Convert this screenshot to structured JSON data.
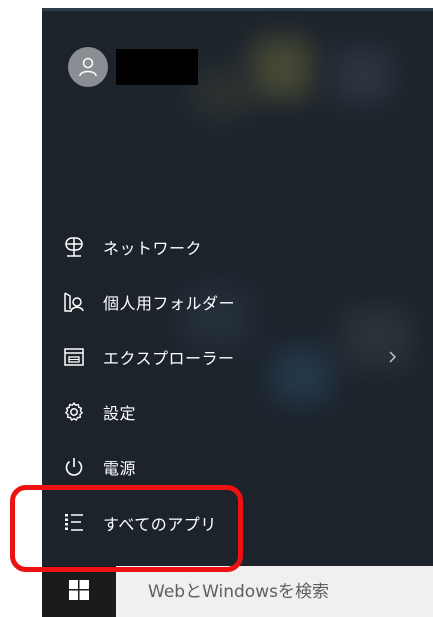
{
  "start_menu": {
    "user": {
      "avatar_icon": "person-icon",
      "name_redacted": true
    },
    "items": [
      {
        "label": "ネットワーク",
        "icon": "network-icon"
      },
      {
        "label": "個人用フォルダー",
        "icon": "personal-folder-icon"
      },
      {
        "label": "エクスプローラー",
        "icon": "file-explorer-icon",
        "has_submenu": true
      },
      {
        "label": "設定",
        "icon": "gear-icon"
      },
      {
        "label": "電源",
        "icon": "power-icon"
      },
      {
        "label": "すべてのアプリ",
        "icon": "list-icon",
        "highlighted": true
      }
    ]
  },
  "taskbar": {
    "start_icon": "windows-logo-icon",
    "search_placeholder": "WebとWindowsを検索"
  },
  "colors": {
    "menu_background": "#1c232b",
    "highlight_border": "#ee1111",
    "search_background": "#f0f0f0"
  }
}
